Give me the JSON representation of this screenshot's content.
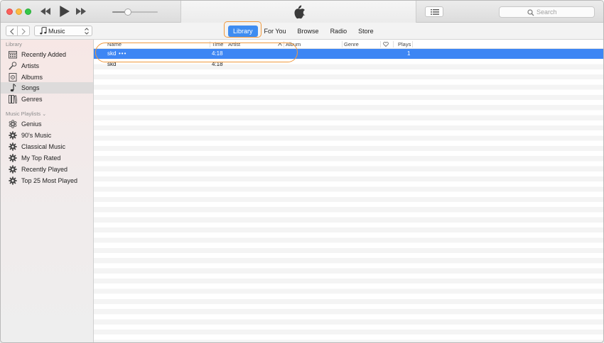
{
  "window": {
    "title": ""
  },
  "search": {
    "placeholder": "Search"
  },
  "player": {
    "volume_fraction": 0.35
  },
  "toolbar": {
    "source": "Music",
    "tabs": [
      {
        "label": "Library",
        "active": true
      },
      {
        "label": "For You",
        "active": false
      },
      {
        "label": "Browse",
        "active": false
      },
      {
        "label": "Radio",
        "active": false
      },
      {
        "label": "Store",
        "active": false
      }
    ]
  },
  "sidebar": {
    "library_title": "Library",
    "library_items": [
      {
        "label": "Recently Added",
        "icon": "recently-added-icon"
      },
      {
        "label": "Artists",
        "icon": "artists-icon"
      },
      {
        "label": "Albums",
        "icon": "albums-icon"
      },
      {
        "label": "Songs",
        "icon": "songs-icon",
        "selected": true
      },
      {
        "label": "Genres",
        "icon": "genres-icon"
      }
    ],
    "playlists_title": "Music Playlists",
    "playlist_items": [
      {
        "label": "Genius",
        "icon": "genius-icon"
      },
      {
        "label": "90's Music",
        "icon": "smart-playlist-icon"
      },
      {
        "label": "Classical Music",
        "icon": "smart-playlist-icon"
      },
      {
        "label": "My Top Rated",
        "icon": "smart-playlist-icon"
      },
      {
        "label": "Recently Played",
        "icon": "smart-playlist-icon"
      },
      {
        "label": "Top 25 Most Played",
        "icon": "smart-playlist-icon"
      }
    ]
  },
  "table": {
    "columns": [
      "Name",
      "Time",
      "Artist",
      "Album",
      "Genre",
      "Plays"
    ],
    "rows": [
      {
        "name": "skd",
        "more": "•••",
        "time": "4:18",
        "artist": "",
        "album": "",
        "genre": "",
        "plays": "1",
        "selected": true
      },
      {
        "name": "skd",
        "more": "",
        "time": "4:18",
        "artist": "",
        "album": "",
        "genre": "",
        "plays": "",
        "selected": false
      }
    ]
  },
  "colors": {
    "accent": "#3e8cf1",
    "selection": "#3d86f4",
    "annotation": "#f0993e"
  }
}
